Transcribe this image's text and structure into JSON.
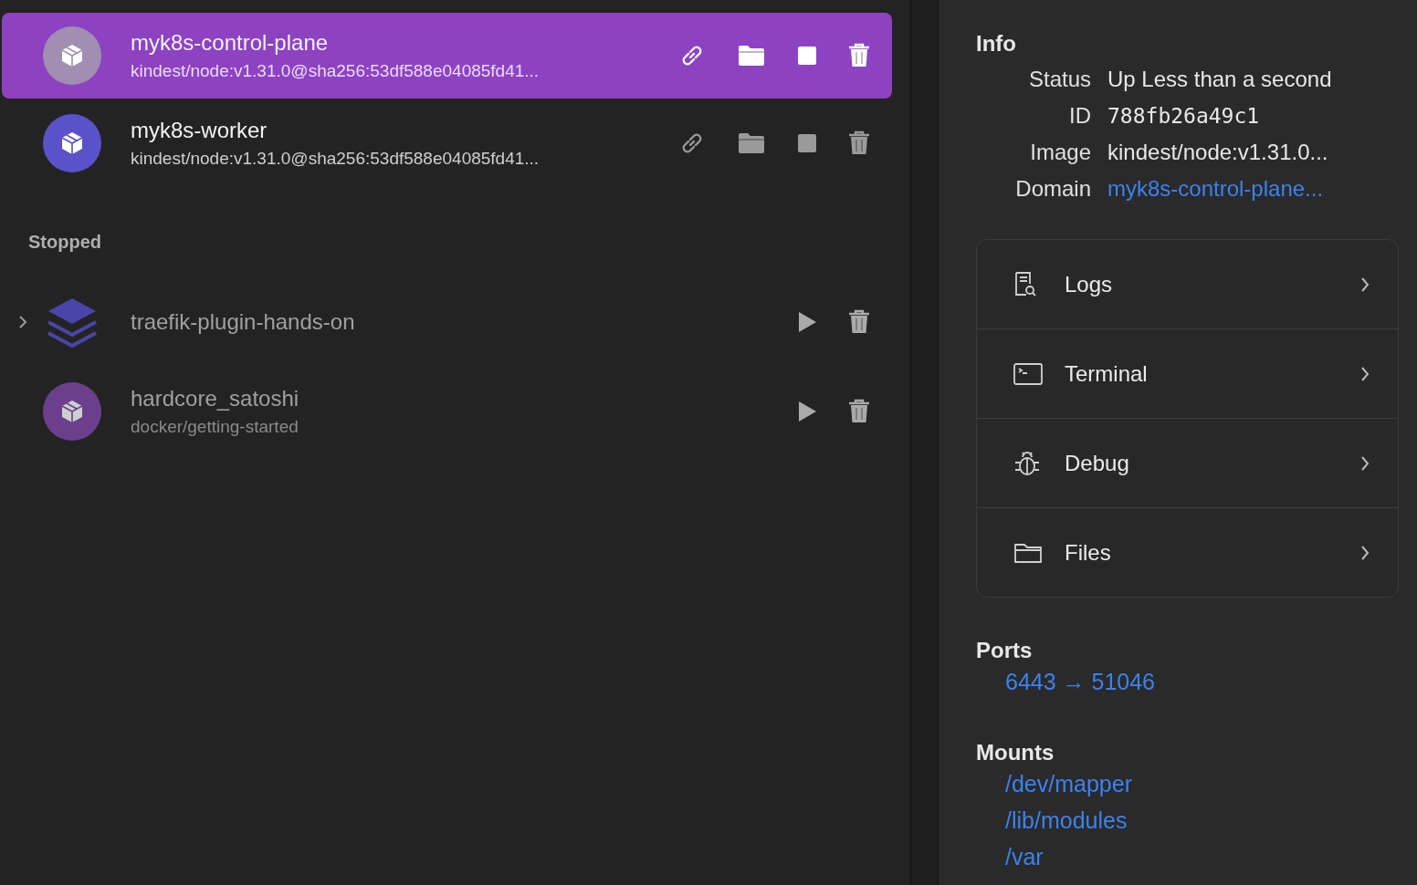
{
  "containers": [
    {
      "name": "myk8s-control-plane",
      "image": "kindest/node:v1.31.0@sha256:53df588e04085fd41...",
      "kind": "container",
      "running": true,
      "selected": true,
      "color": "#a08fb0"
    },
    {
      "name": "myk8s-worker",
      "image": "kindest/node:v1.31.0@sha256:53df588e04085fd41...",
      "kind": "container",
      "running": true,
      "selected": false,
      "color": "#5a52c8"
    }
  ],
  "stopped": {
    "title": "Stopped",
    "items": [
      {
        "name": "traefik-plugin-hands-on",
        "kind": "compose",
        "running": false,
        "selected": false,
        "expanded": false,
        "color": "#4a45a8"
      },
      {
        "name": "hardcore_satoshi",
        "image": "docker/getting-started",
        "kind": "container",
        "running": false,
        "selected": false,
        "color": "#6b3f8c"
      }
    ]
  },
  "info": {
    "title": "Info",
    "rows": [
      {
        "label": "Status",
        "value": "Up Less than a second",
        "kind": "text"
      },
      {
        "label": "ID",
        "value": "788fb26a49c1",
        "kind": "mono"
      },
      {
        "label": "Image",
        "value": "kindest/node:v1.31.0...",
        "kind": "text"
      },
      {
        "label": "Domain",
        "value": "myk8s-control-plane...",
        "kind": "link"
      }
    ]
  },
  "actions": [
    {
      "label": "Logs",
      "kind": "logs"
    },
    {
      "label": "Terminal",
      "kind": "terminal"
    },
    {
      "label": "Debug",
      "kind": "debug"
    },
    {
      "label": "Files",
      "kind": "files"
    }
  ],
  "ports": {
    "title": "Ports",
    "items": [
      "6443 → 51046"
    ]
  },
  "mounts": {
    "title": "Mounts",
    "items": [
      "/dev/mapper",
      "/lib/modules",
      "/var"
    ]
  }
}
